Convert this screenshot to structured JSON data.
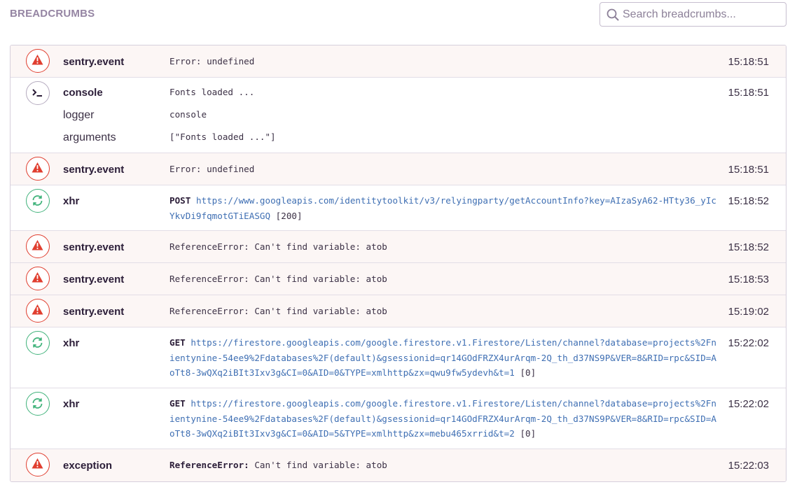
{
  "header": {
    "title": "BREADCRUMBS",
    "search_placeholder": "Search breadcrumbs..."
  },
  "colors": {
    "error": "#e03e2f",
    "xhr": "#3fb27a",
    "console": "#b5abbf",
    "url": "#3f6fb3"
  },
  "rows": [
    {
      "icon": "warning-icon",
      "category": "sentry.event",
      "message": "Error: undefined",
      "time": "15:18:51"
    },
    {
      "icon": "terminal-icon",
      "category": "console",
      "message": "Fonts loaded ...",
      "time": "15:18:51",
      "data": [
        {
          "key": "logger",
          "value": "console"
        },
        {
          "key": "arguments",
          "value": "[\"Fonts loaded ...\"]"
        }
      ]
    },
    {
      "icon": "warning-icon",
      "category": "sentry.event",
      "message": "Error: undefined",
      "time": "15:18:51"
    },
    {
      "icon": "refresh-icon",
      "category": "xhr",
      "method": "POST",
      "url": "https://www.googleapis.com/identitytoolkit/v3/relyingparty/getAccountInfo?key=AIzaSyA62-HTty36_yIcYkvDi9fqmotGTiEASGQ",
      "status": "[200]",
      "time": "15:18:52"
    },
    {
      "icon": "warning-icon",
      "category": "sentry.event",
      "message": "ReferenceError: Can't find variable: atob",
      "time": "15:18:52"
    },
    {
      "icon": "warning-icon",
      "category": "sentry.event",
      "message": "ReferenceError: Can't find variable: atob",
      "time": "15:18:53"
    },
    {
      "icon": "warning-icon",
      "category": "sentry.event",
      "message": "ReferenceError: Can't find variable: atob",
      "time": "15:19:02"
    },
    {
      "icon": "refresh-icon",
      "category": "xhr",
      "method": "GET",
      "url": "https://firestore.googleapis.com/google.firestore.v1.Firestore/Listen/channel?database=projects%2Fnientynine-54ee9%2Fdatabases%2F(default)&gsessionid=qr14GOdFRZX4urArqm-2Q_th_d37NS9P&VER=8&RID=rpc&SID=AoTt8-3wQXq2iBIt3Ixv3g&CI=0&AID=0&TYPE=xmlhttp&zx=qwu9fw5ydevh&t=1",
      "status": "[0]",
      "time": "15:22:02"
    },
    {
      "icon": "refresh-icon",
      "category": "xhr",
      "method": "GET",
      "url": "https://firestore.googleapis.com/google.firestore.v1.Firestore/Listen/channel?database=projects%2Fnientynine-54ee9%2Fdatabases%2F(default)&gsessionid=qr14GOdFRZX4urArqm-2Q_th_d37NS9P&VER=8&RID=rpc&SID=AoTt8-3wQXq2iBIt3Ixv3g&CI=0&AID=5&TYPE=xmlhttp&zx=mebu465xrrid&t=2",
      "status": "[0]",
      "time": "15:22:02"
    },
    {
      "icon": "warning-icon",
      "category": "exception",
      "error_type": "ReferenceError:",
      "message": "Can't find variable: atob",
      "time": "15:22:03"
    }
  ]
}
